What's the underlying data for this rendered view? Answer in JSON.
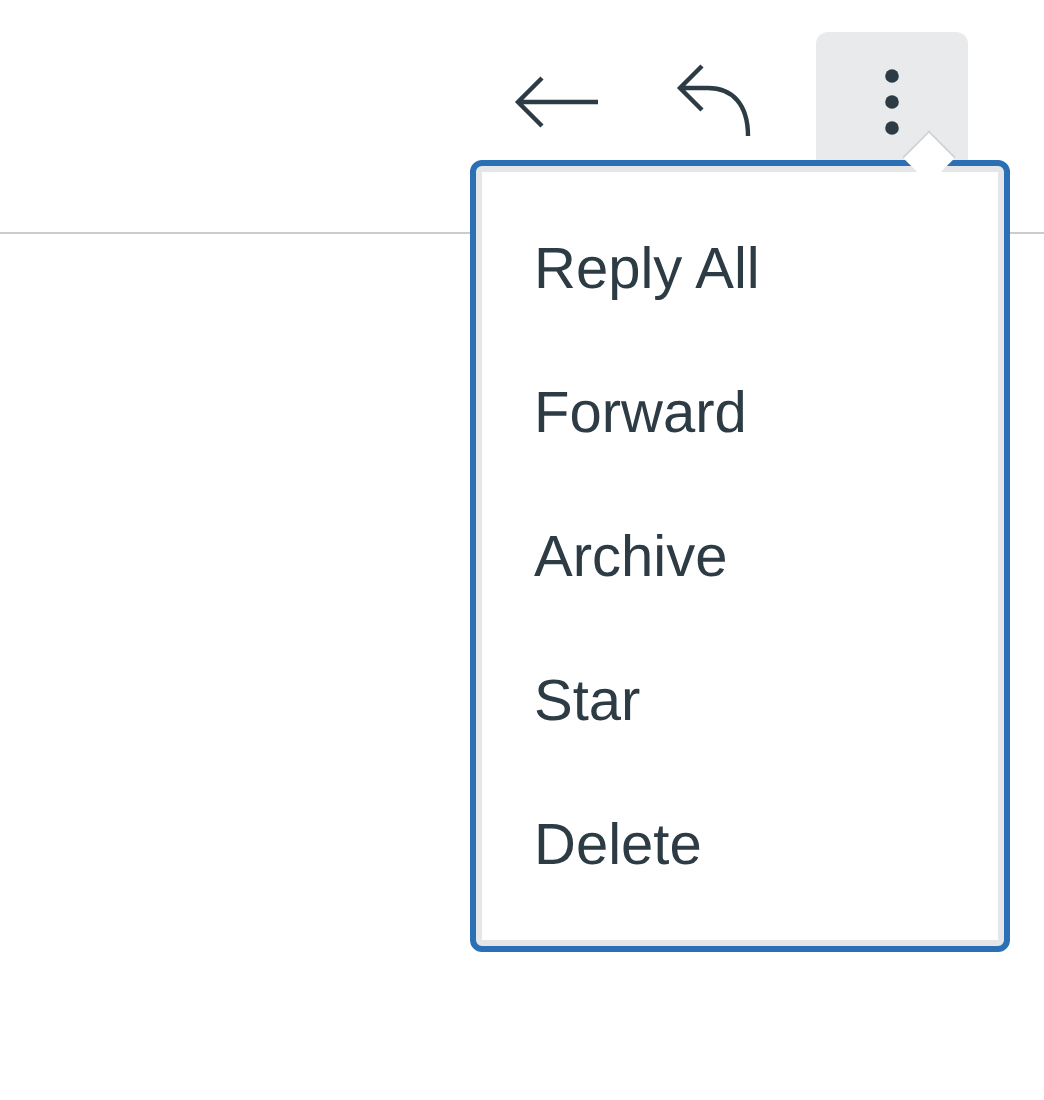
{
  "toolbar": [
    {
      "kind": "back",
      "expanded": false
    },
    {
      "kind": "reply",
      "expanded": false
    },
    {
      "kind": "more",
      "expanded": true
    }
  ],
  "menu": {
    "items": [
      {
        "label": "Reply All"
      },
      {
        "label": "Forward"
      },
      {
        "label": "Archive"
      },
      {
        "label": "Star"
      },
      {
        "label": "Delete"
      }
    ]
  }
}
